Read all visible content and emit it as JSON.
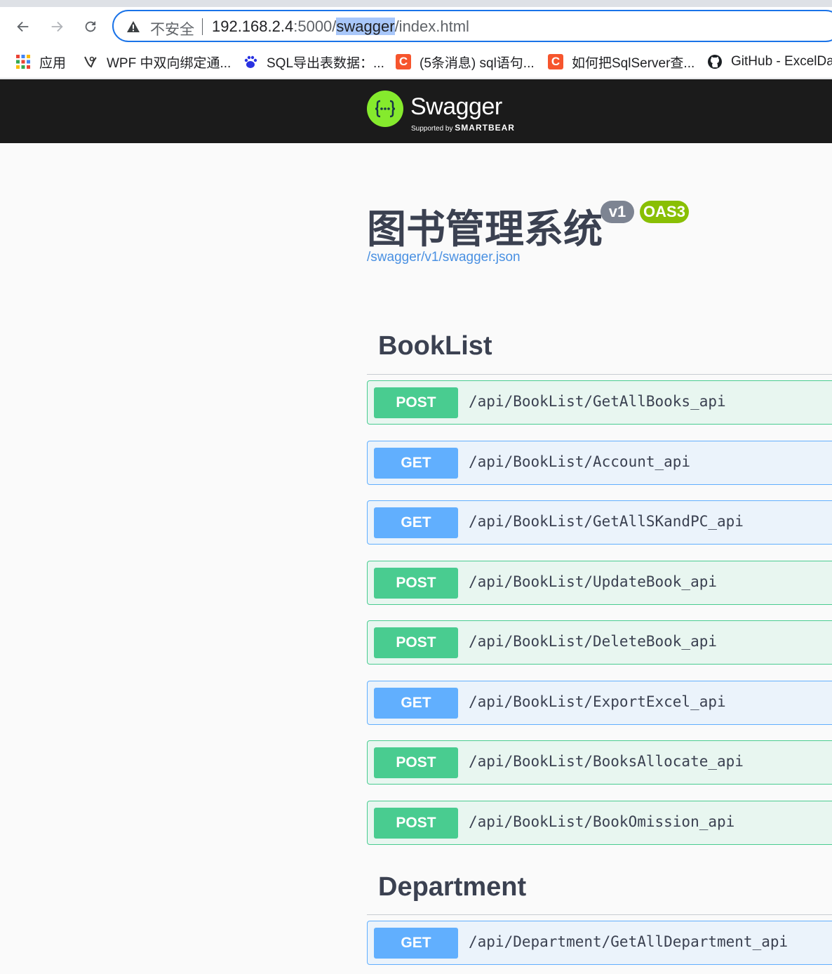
{
  "browser": {
    "insecure_label": "不安全",
    "url_host": "192.168.2.4",
    "url_port": ":5000/",
    "url_selected": "swagger",
    "url_rest": "/index.html",
    "bookmarks": [
      {
        "label": "应用",
        "icon": "apps-grid-icon"
      },
      {
        "label": "WPF 中双向绑定通...",
        "icon": "bookmark-site-icon"
      },
      {
        "label": "SQL导出表数据：...",
        "icon": "baidu-paw-icon"
      },
      {
        "label": "(5条消息) sql语句...",
        "icon": "csdn-icon"
      },
      {
        "label": "如何把SqlServer查...",
        "icon": "csdn-icon"
      },
      {
        "label": "GitHub - ExcelDa",
        "icon": "github-icon"
      }
    ]
  },
  "swagger": {
    "brand": "Swagger",
    "supported_by": "Supported by",
    "smartbear": "SMARTBEAR"
  },
  "info": {
    "title": "图书管理系统",
    "version": "v1",
    "oas": "OAS3",
    "spec_url": "/swagger/v1/swagger.json"
  },
  "sections": [
    {
      "name": "BookList",
      "operations": [
        {
          "method": "POST",
          "path": "/api/BookList/GetAllBooks_api"
        },
        {
          "method": "GET",
          "path": "/api/BookList/Account_api"
        },
        {
          "method": "GET",
          "path": "/api/BookList/GetAllSKandPC_api"
        },
        {
          "method": "POST",
          "path": "/api/BookList/UpdateBook_api"
        },
        {
          "method": "POST",
          "path": "/api/BookList/DeleteBook_api"
        },
        {
          "method": "GET",
          "path": "/api/BookList/ExportExcel_api"
        },
        {
          "method": "POST",
          "path": "/api/BookList/BooksAllocate_api"
        },
        {
          "method": "POST",
          "path": "/api/BookList/BookOmission_api"
        }
      ]
    },
    {
      "name": "Department",
      "operations": [
        {
          "method": "GET",
          "path": "/api/Department/GetAllDepartment_api"
        }
      ]
    }
  ],
  "colors": {
    "post": "#49cc90",
    "get": "#61affe",
    "topbar": "#1b1b1b",
    "swagger_green": "#85ea2d"
  }
}
